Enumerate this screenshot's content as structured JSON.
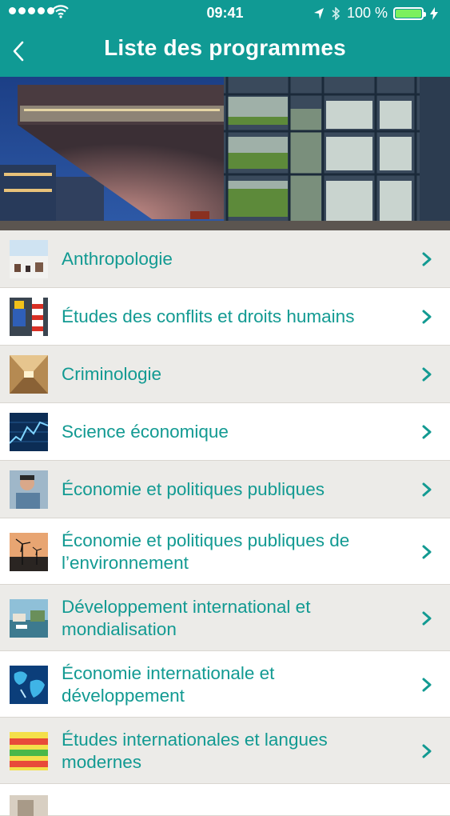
{
  "status_bar": {
    "time": "09:41",
    "battery": "100 %",
    "icons": [
      "signal-dots-icon",
      "wifi-icon",
      "location-arrow-icon",
      "bluetooth-icon",
      "battery-icon",
      "charging-bolt-icon"
    ]
  },
  "nav": {
    "title": "Liste des programmes",
    "back_icon": "chevron-left-icon"
  },
  "colors": {
    "header": "#109a94",
    "accent_text": "#129a92",
    "row_gray": "#ecebe8",
    "row_white": "#ffffff"
  },
  "programs": [
    {
      "label": "Anthropologie",
      "thumb": "snow-landscape-thumbnail"
    },
    {
      "label": "Études des conflits et droits humains",
      "thumb": "lego-figure-thumbnail"
    },
    {
      "label": "Criminologie",
      "thumb": "corridor-thumbnail"
    },
    {
      "label": "Science économique",
      "thumb": "stock-chart-thumbnail"
    },
    {
      "label": "Économie et politiques publiques",
      "thumb": "person-portrait-thumbnail"
    },
    {
      "label": "Économie et politiques publiques de l’environnement",
      "thumb": "wind-turbines-thumbnail"
    },
    {
      "label": "Développement international et mondialisation",
      "thumb": "harbor-boats-thumbnail"
    },
    {
      "label": "Économie internationale et développement",
      "thumb": "world-map-thumbnail"
    },
    {
      "label": "Études internationales et langues modernes",
      "thumb": "multilingual-thanks-thumbnail"
    }
  ]
}
